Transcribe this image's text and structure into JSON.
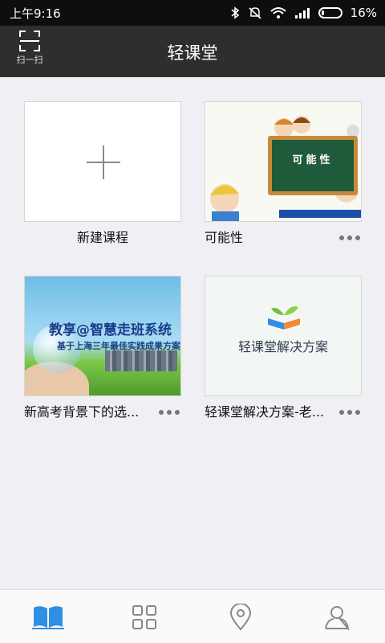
{
  "status_bar": {
    "time": "上午9:16",
    "battery_percent": "16%",
    "battery_level": 0.16
  },
  "header": {
    "title": "轻课堂",
    "scan_label": "扫一扫"
  },
  "courses": [
    {
      "caption": "新建课程",
      "kind": "new"
    },
    {
      "caption": "可能性",
      "kind": "course",
      "thumb_text": "可能性"
    },
    {
      "caption": "新高考背景下的选...",
      "kind": "course",
      "thumb_title": "教享@智慧走班系统",
      "thumb_subtitle": "基于上海三年最佳实践成果方案"
    },
    {
      "caption": "轻课堂解决方案-老...",
      "kind": "course",
      "thumb_title": "轻课堂解决方案"
    }
  ],
  "tabs": [
    {
      "icon": "book-icon",
      "active": true
    },
    {
      "icon": "grid-icon",
      "active": false
    },
    {
      "icon": "location-icon",
      "active": false
    },
    {
      "icon": "user-icon",
      "active": false
    }
  ],
  "colors": {
    "accent": "#2f8fe0",
    "header_bg": "#2e2e2e",
    "page_bg": "#efeff4"
  }
}
